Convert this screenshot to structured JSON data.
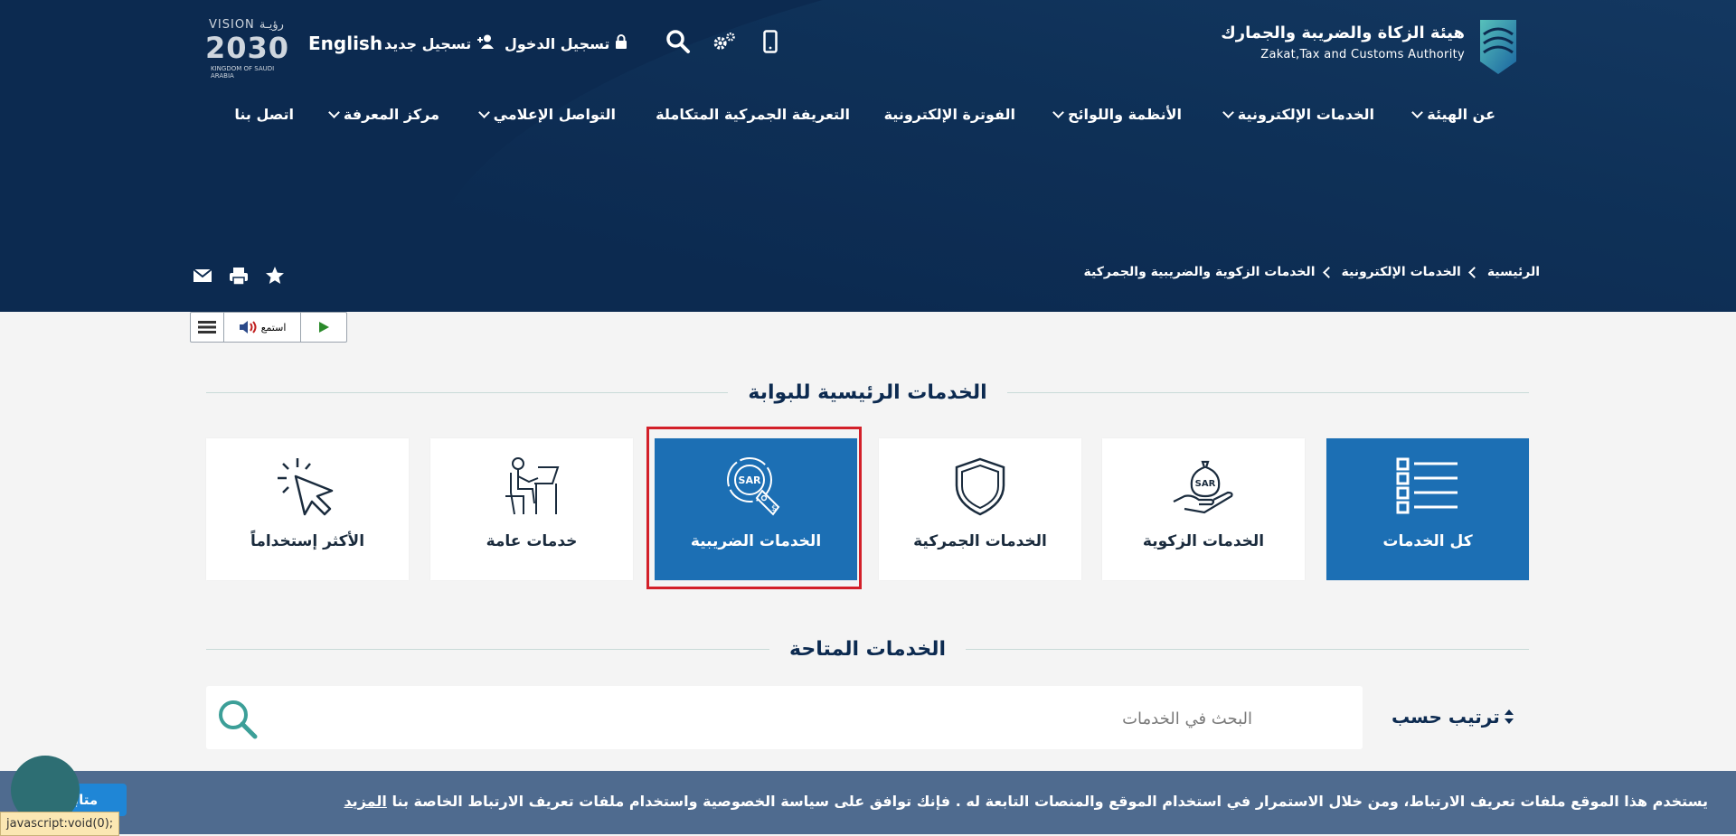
{
  "header": {
    "org_name_ar": "هيئة الزكاة والضريبة والجمارك",
    "org_name_en": "Zakat,Tax and Customs Authority",
    "login_label": "تسجيل الدخول",
    "register_label": "تسجيل جديد",
    "language_label": "English",
    "vision": {
      "label": "VISION",
      "year": "2030",
      "ar": "رؤيـة",
      "sub": "KINGDOM OF SAUDI ARABIA"
    }
  },
  "nav": {
    "items": [
      {
        "label": "عن الهيئة"
      },
      {
        "label": "الخدمات الإلكترونية"
      },
      {
        "label": "الأنظمة واللوائح"
      },
      {
        "label": "الفوترة الإلكترونية"
      },
      {
        "label": "التعريفة الجمركية المتكاملة"
      },
      {
        "label": "التواصل الإعلامي"
      },
      {
        "label": "مركز المعرفة"
      },
      {
        "label": "اتصل بنا"
      }
    ]
  },
  "breadcrumb": {
    "items": [
      "الرئيسية",
      "الخدمات الإلكترونية",
      "الخدمات الزكوية والضريبية والجمركية"
    ]
  },
  "reader": {
    "listen_label": "استمع"
  },
  "main_services": {
    "title": "الخدمات الرئيسية للبوابة",
    "cards": [
      {
        "label": "كل الخدمات",
        "icon": "list-icon"
      },
      {
        "label": "الخدمات الزكوية",
        "icon": "hand-money-bag-icon"
      },
      {
        "label": "الخدمات الجمركية",
        "icon": "shield-icon"
      },
      {
        "label": "الخدمات الضريبية",
        "icon": "sar-tax-icon"
      },
      {
        "label": "خدمات عامة",
        "icon": "person-at-desk-icon"
      },
      {
        "label": "الأكثر إستخداماً",
        "icon": "cursor-click-icon"
      }
    ]
  },
  "available_services": {
    "title": "الخدمات المتاحة",
    "sort_label": "ترتيب حسب",
    "search_placeholder": "البحث في الخدمات"
  },
  "cookie": {
    "message": "يستخدم هذا الموقع ملفات تعريف الارتباط، ومن خلال الاستمرار في استخدام الموقع والمنصات التابعة له . فإنك توافق على سياسة الخصوصية واستخدام ملفات تعريف الارتباط الخاصة بنا",
    "more_label": "المزيد",
    "continue_label": "متابعة"
  },
  "status_bar": "javascript:void(0);",
  "colors": {
    "navy": "#0c2a50",
    "card_blue": "#1c6fb4",
    "highlight": "#d32029",
    "cookie_bar": "#4f6b8f"
  }
}
